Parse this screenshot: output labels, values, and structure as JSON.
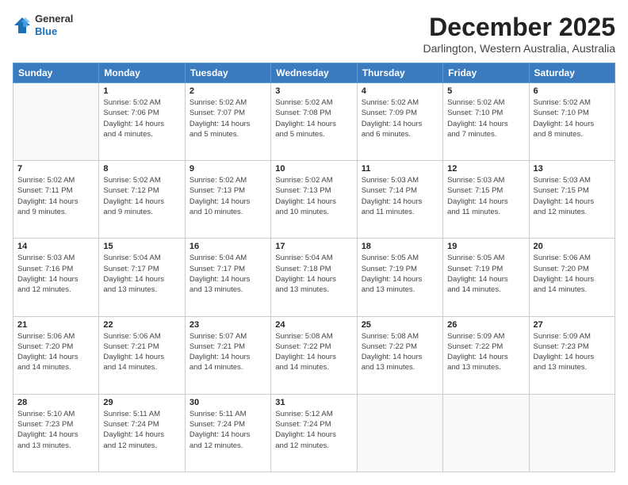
{
  "header": {
    "logo_line1": "General",
    "logo_line2": "Blue",
    "month": "December 2025",
    "location": "Darlington, Western Australia, Australia"
  },
  "weekdays": [
    "Sunday",
    "Monday",
    "Tuesday",
    "Wednesday",
    "Thursday",
    "Friday",
    "Saturday"
  ],
  "weeks": [
    [
      {
        "day": "",
        "info": ""
      },
      {
        "day": "1",
        "info": "Sunrise: 5:02 AM\nSunset: 7:06 PM\nDaylight: 14 hours\nand 4 minutes."
      },
      {
        "day": "2",
        "info": "Sunrise: 5:02 AM\nSunset: 7:07 PM\nDaylight: 14 hours\nand 5 minutes."
      },
      {
        "day": "3",
        "info": "Sunrise: 5:02 AM\nSunset: 7:08 PM\nDaylight: 14 hours\nand 5 minutes."
      },
      {
        "day": "4",
        "info": "Sunrise: 5:02 AM\nSunset: 7:09 PM\nDaylight: 14 hours\nand 6 minutes."
      },
      {
        "day": "5",
        "info": "Sunrise: 5:02 AM\nSunset: 7:10 PM\nDaylight: 14 hours\nand 7 minutes."
      },
      {
        "day": "6",
        "info": "Sunrise: 5:02 AM\nSunset: 7:10 PM\nDaylight: 14 hours\nand 8 minutes."
      }
    ],
    [
      {
        "day": "7",
        "info": "Sunrise: 5:02 AM\nSunset: 7:11 PM\nDaylight: 14 hours\nand 9 minutes."
      },
      {
        "day": "8",
        "info": "Sunrise: 5:02 AM\nSunset: 7:12 PM\nDaylight: 14 hours\nand 9 minutes."
      },
      {
        "day": "9",
        "info": "Sunrise: 5:02 AM\nSunset: 7:13 PM\nDaylight: 14 hours\nand 10 minutes."
      },
      {
        "day": "10",
        "info": "Sunrise: 5:02 AM\nSunset: 7:13 PM\nDaylight: 14 hours\nand 10 minutes."
      },
      {
        "day": "11",
        "info": "Sunrise: 5:03 AM\nSunset: 7:14 PM\nDaylight: 14 hours\nand 11 minutes."
      },
      {
        "day": "12",
        "info": "Sunrise: 5:03 AM\nSunset: 7:15 PM\nDaylight: 14 hours\nand 11 minutes."
      },
      {
        "day": "13",
        "info": "Sunrise: 5:03 AM\nSunset: 7:15 PM\nDaylight: 14 hours\nand 12 minutes."
      }
    ],
    [
      {
        "day": "14",
        "info": "Sunrise: 5:03 AM\nSunset: 7:16 PM\nDaylight: 14 hours\nand 12 minutes."
      },
      {
        "day": "15",
        "info": "Sunrise: 5:04 AM\nSunset: 7:17 PM\nDaylight: 14 hours\nand 13 minutes."
      },
      {
        "day": "16",
        "info": "Sunrise: 5:04 AM\nSunset: 7:17 PM\nDaylight: 14 hours\nand 13 minutes."
      },
      {
        "day": "17",
        "info": "Sunrise: 5:04 AM\nSunset: 7:18 PM\nDaylight: 14 hours\nand 13 minutes."
      },
      {
        "day": "18",
        "info": "Sunrise: 5:05 AM\nSunset: 7:19 PM\nDaylight: 14 hours\nand 13 minutes."
      },
      {
        "day": "19",
        "info": "Sunrise: 5:05 AM\nSunset: 7:19 PM\nDaylight: 14 hours\nand 14 minutes."
      },
      {
        "day": "20",
        "info": "Sunrise: 5:06 AM\nSunset: 7:20 PM\nDaylight: 14 hours\nand 14 minutes."
      }
    ],
    [
      {
        "day": "21",
        "info": "Sunrise: 5:06 AM\nSunset: 7:20 PM\nDaylight: 14 hours\nand 14 minutes."
      },
      {
        "day": "22",
        "info": "Sunrise: 5:06 AM\nSunset: 7:21 PM\nDaylight: 14 hours\nand 14 minutes."
      },
      {
        "day": "23",
        "info": "Sunrise: 5:07 AM\nSunset: 7:21 PM\nDaylight: 14 hours\nand 14 minutes."
      },
      {
        "day": "24",
        "info": "Sunrise: 5:08 AM\nSunset: 7:22 PM\nDaylight: 14 hours\nand 14 minutes."
      },
      {
        "day": "25",
        "info": "Sunrise: 5:08 AM\nSunset: 7:22 PM\nDaylight: 14 hours\nand 13 minutes."
      },
      {
        "day": "26",
        "info": "Sunrise: 5:09 AM\nSunset: 7:22 PM\nDaylight: 14 hours\nand 13 minutes."
      },
      {
        "day": "27",
        "info": "Sunrise: 5:09 AM\nSunset: 7:23 PM\nDaylight: 14 hours\nand 13 minutes."
      }
    ],
    [
      {
        "day": "28",
        "info": "Sunrise: 5:10 AM\nSunset: 7:23 PM\nDaylight: 14 hours\nand 13 minutes."
      },
      {
        "day": "29",
        "info": "Sunrise: 5:11 AM\nSunset: 7:24 PM\nDaylight: 14 hours\nand 12 minutes."
      },
      {
        "day": "30",
        "info": "Sunrise: 5:11 AM\nSunset: 7:24 PM\nDaylight: 14 hours\nand 12 minutes."
      },
      {
        "day": "31",
        "info": "Sunrise: 5:12 AM\nSunset: 7:24 PM\nDaylight: 14 hours\nand 12 minutes."
      },
      {
        "day": "",
        "info": ""
      },
      {
        "day": "",
        "info": ""
      },
      {
        "day": "",
        "info": ""
      }
    ]
  ]
}
